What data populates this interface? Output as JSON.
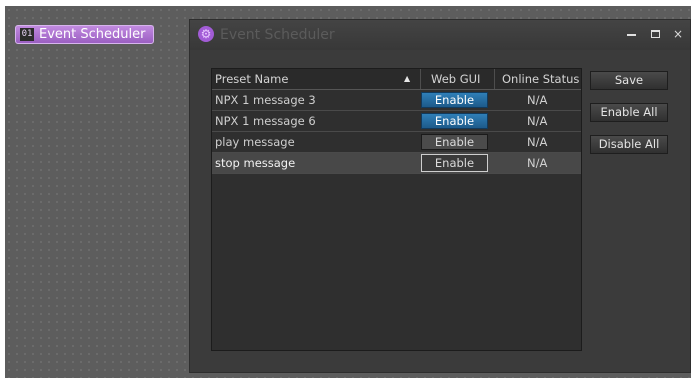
{
  "node": {
    "icon_text": "01",
    "label": "Event Scheduler",
    "color": "#b07ad6"
  },
  "window": {
    "title": "Event Scheduler",
    "icon": "gear-icon",
    "controls": {
      "minimize": "",
      "maximize": "",
      "close": "×"
    }
  },
  "table": {
    "columns": {
      "name": "Preset Name",
      "sort_indicator": "▲",
      "web_gui": "Web GUI",
      "online_status": "Online Status"
    },
    "rows": [
      {
        "name": "NPX 1 message 3",
        "web_gui": "Enable",
        "online_status": "N/A",
        "style": "blue"
      },
      {
        "name": "NPX 1 message 6",
        "web_gui": "Enable",
        "online_status": "N/A",
        "style": "blue"
      },
      {
        "name": "play message",
        "web_gui": "Enable",
        "online_status": "N/A",
        "style": "grey"
      },
      {
        "name": "stop message",
        "web_gui": "Enable",
        "online_status": "N/A",
        "style": "outlined"
      }
    ]
  },
  "buttons": {
    "save": "Save",
    "enable_all": "Enable All",
    "disable_all": "Disable All"
  },
  "colors": {
    "enable_active": "#2f7fb8",
    "window_bg": "#3b3b3b",
    "canvas_bg": "#5d5d5d"
  }
}
